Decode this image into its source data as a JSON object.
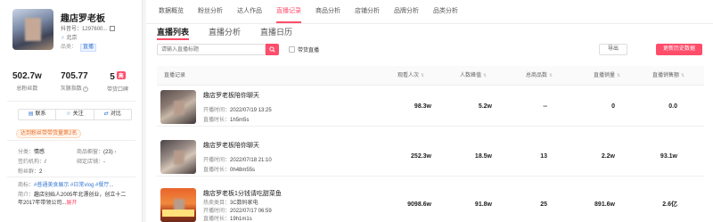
{
  "profile": {
    "name": "趣店罗老板",
    "id_label": "抖音号：",
    "id_value": "1297600...",
    "location": "北京",
    "brand_label": "品类：",
    "brand_badge": "直播",
    "stats": [
      {
        "value": "502.7w",
        "label": "总粉丝数"
      },
      {
        "value": "705.77",
        "label": "灰豚指数"
      },
      {
        "value": "5",
        "rank": "高",
        "label": "带货口碑"
      }
    ],
    "actions": [
      {
        "icon": "contact-icon",
        "label": "联系"
      },
      {
        "icon": "star-icon",
        "label": "关注"
      },
      {
        "icon": "compare-icon",
        "label": "对比"
      }
    ],
    "tagline": "达到粉丝带带货量第2名",
    "info": {
      "category_label": "分类：",
      "category_value": "情感",
      "goods_label": "商品橱窗：",
      "goods_value": "(23)",
      "mcn_label": "签约机构：",
      "mcn_value": "/",
      "shop_label": "绑定店铺：",
      "shop_value": "-",
      "star_label": "粉丝群：",
      "star_value": "2",
      "tags_label": "商标：",
      "tags_value": "#普通美食展示  #日常vlog  #餐厅...",
      "bio_label": "简介：",
      "bio_value": "趣店创始人2005年北漂创业，创立十二",
      "bio_line2": "年2017年带领公司...",
      "bio_more": "展开"
    }
  },
  "nav": {
    "tabs": [
      "数据概览",
      "粉丝分析",
      "达人作品",
      "直播记录",
      "商品分析",
      "店铺分析",
      "品牌分析",
      "品类分析"
    ],
    "active": "直播记录"
  },
  "subtabs": [
    "直播列表",
    "直播分析",
    "直播日历"
  ],
  "search": {
    "placeholder": "请输入直播标题"
  },
  "filter_label": "带货直播",
  "buttons": {
    "export": "导出",
    "update": "更新历史数据"
  },
  "table": {
    "headers": {
      "record": "直播记录",
      "views": "观看人次",
      "peak": "人数峰值",
      "goods": "总商品数",
      "sales": "直播销量",
      "revenue": "直播销售额"
    },
    "start_label": "开播时间：",
    "duration_label": "直播时长：",
    "rows": [
      {
        "title": "趣店罗老板陪你聊天",
        "start": "2022/07/19 13:25",
        "duration": "1h5m5s",
        "views": "98.3w",
        "peak": "5.2w",
        "goods": "--",
        "sales": "0",
        "revenue": "0.0"
      },
      {
        "title": "趣店罗老板陪你聊天",
        "start": "2022/07/18 21:10",
        "duration": "0h48m55s",
        "views": "252.3w",
        "peak": "18.5w",
        "goods": "13",
        "sales": "2.2w",
        "revenue": "93.1w"
      },
      {
        "title": "趣店罗老板1分钱请吃甜菜鱼",
        "hot_label": "热卖类目：",
        "hot_value": "3C数码家电",
        "start": "2022/07/17 06:59",
        "duration": "19h1m1s",
        "views": "9098.6w",
        "peak": "91.8w",
        "goods": "25",
        "sales": "891.6w",
        "revenue": "2.6亿"
      }
    ]
  },
  "colors": {
    "accent": "#ff4d6a",
    "link": "#3a7bd5",
    "orange": "#e8702a"
  }
}
